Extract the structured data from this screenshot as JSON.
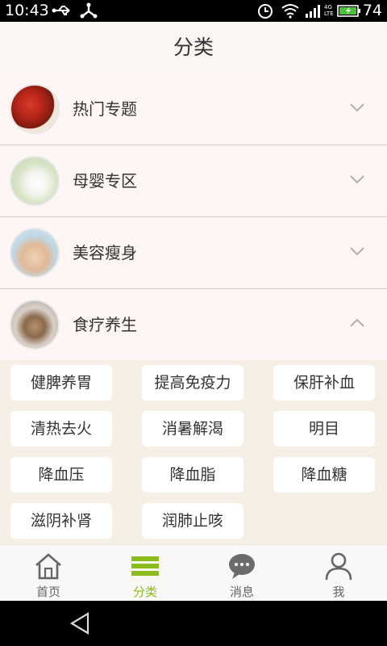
{
  "status_bar": {
    "time": "10:43",
    "battery_percent": "74",
    "network_label": "4G LTE",
    "icons": [
      "usb-icon",
      "debug-icon",
      "alarm-icon",
      "wifi-icon",
      "signal-icon",
      "battery-charging-icon"
    ]
  },
  "header": {
    "title": "分类"
  },
  "categories": [
    {
      "label": "热门专题",
      "icon": "hot-topic-thumb",
      "expanded": false
    },
    {
      "label": "母婴专区",
      "icon": "mother-baby-thumb",
      "expanded": false
    },
    {
      "label": "美容瘦身",
      "icon": "beauty-slimming-thumb",
      "expanded": false
    },
    {
      "label": "食疗养生",
      "icon": "diet-therapy-thumb",
      "expanded": true
    }
  ],
  "subcategories": [
    "健脾养胃",
    "提高免疫力",
    "保肝补血",
    "清热去火",
    "消暑解渴",
    "明目",
    "降血压",
    "降血脂",
    "降血糖",
    "滋阴补肾",
    "润肺止咳"
  ],
  "bottom_nav": {
    "items": [
      {
        "label": "首页",
        "icon": "home-icon",
        "active": false
      },
      {
        "label": "分类",
        "icon": "menu-icon",
        "active": true
      },
      {
        "label": "消息",
        "icon": "message-icon",
        "active": false
      },
      {
        "label": "我",
        "icon": "profile-icon",
        "active": false
      }
    ]
  },
  "colors": {
    "accent": "#8cbc1c",
    "tag_area_bg": "#f5efe6",
    "row_bg": "#fdf6f4"
  }
}
